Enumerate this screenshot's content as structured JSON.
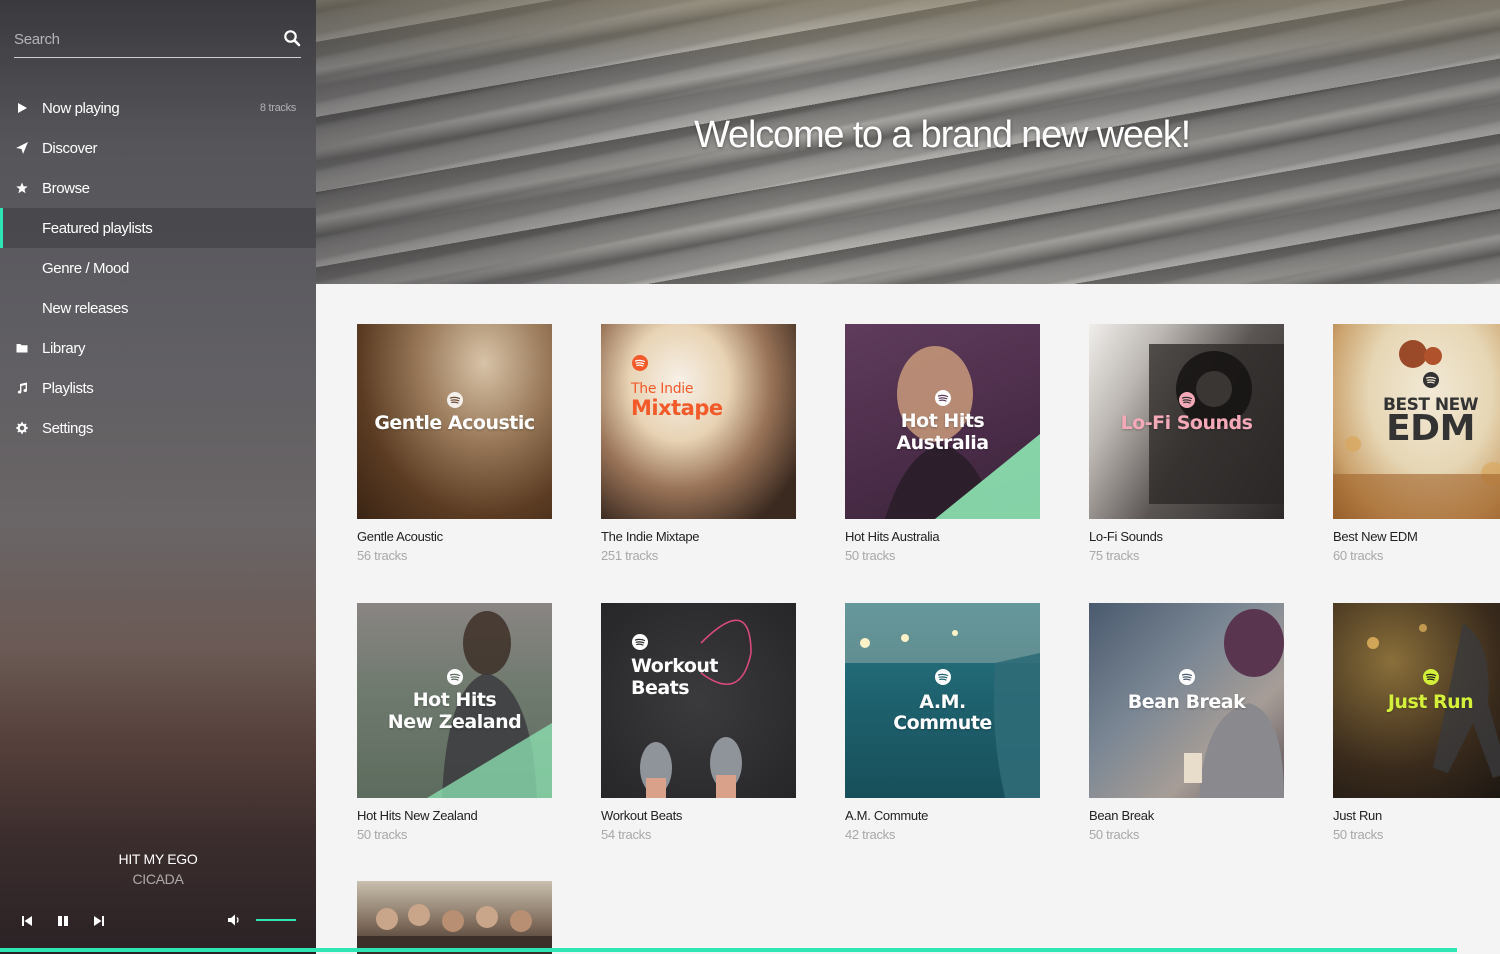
{
  "search": {
    "placeholder": "Search"
  },
  "nav": {
    "now_playing": {
      "label": "Now playing",
      "count": "8 tracks"
    },
    "discover": "Discover",
    "browse": "Browse",
    "featured": "Featured playlists",
    "genre": "Genre / Mood",
    "new_releases": "New releases",
    "library": "Library",
    "playlists": "Playlists",
    "settings": "Settings"
  },
  "player": {
    "track": "HIT MY EGO",
    "artist": "CICADA",
    "volume_fraction": 0.8
  },
  "hero": {
    "title": "Welcome to a brand new week!"
  },
  "accent_color": "#2ee6b3",
  "playlists": [
    {
      "title": "Gentle Acoustic",
      "tracks": "56 tracks",
      "cover_text": "Gentle Acoustic"
    },
    {
      "title": "The Indie Mixtape",
      "tracks": "251 tracks",
      "cover_small": "The Indie",
      "cover_text": "Mixtape"
    },
    {
      "title": "Hot Hits Australia",
      "tracks": "50 tracks",
      "cover_text_1": "Hot Hits",
      "cover_text_2": "Australia"
    },
    {
      "title": "Lo-Fi Sounds",
      "tracks": "75 tracks",
      "cover_text": "Lo-Fi Sounds"
    },
    {
      "title": "Best New EDM",
      "tracks": "60 tracks",
      "cover_text_1": "BEST NEW",
      "cover_text_2": "EDM"
    },
    {
      "title": "Hot Hits New Zealand",
      "tracks": "50 tracks",
      "cover_text_1": "Hot Hits",
      "cover_text_2": "New Zealand"
    },
    {
      "title": "Workout Beats",
      "tracks": "54 tracks",
      "cover_text_1": "Workout",
      "cover_text_2": "Beats"
    },
    {
      "title": "A.M. Commute",
      "tracks": "42 tracks",
      "cover_text_1": "A.M.",
      "cover_text_2": "Commute"
    },
    {
      "title": "Bean Break",
      "tracks": "50 tracks",
      "cover_text": "Bean Break"
    },
    {
      "title": "Just Run",
      "tracks": "50 tracks",
      "cover_text": "Just Run"
    },
    {
      "title": "",
      "tracks": ""
    }
  ]
}
